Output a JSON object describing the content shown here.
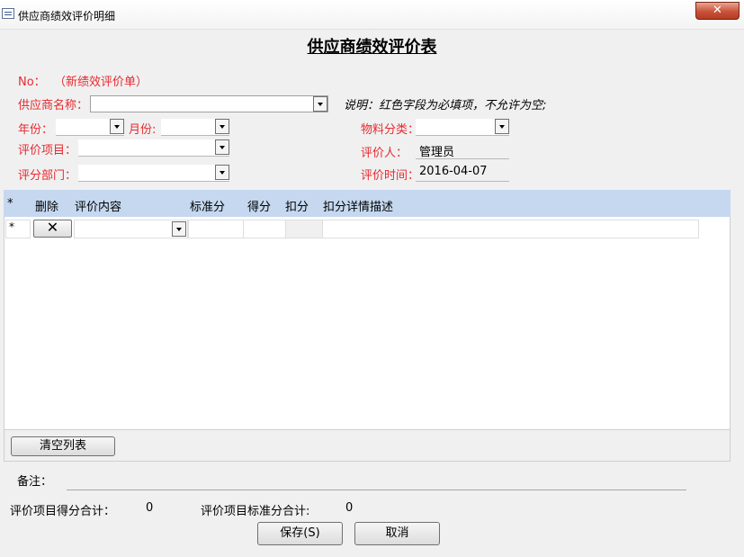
{
  "window": {
    "title": "供应商绩效评价明细",
    "close_label": "✕"
  },
  "form": {
    "title": "供应商绩效评价表",
    "no_label": "No：",
    "no_value": "（新绩效评价单）",
    "supplier_label": "供应商名称：",
    "supplier_value": "",
    "note_text": "说明：红色字段为必填项，不允许为空;",
    "year_label": "年份：",
    "year_value": "",
    "month_label": "月份:",
    "month_value": "",
    "material_label": "物料分类：",
    "material_value": "",
    "item_label": "评价项目：",
    "item_value": "",
    "evaluator_label": "评价人：",
    "evaluator_value": "管理员",
    "dept_label": "评分部门：",
    "dept_value": "",
    "eval_time_label": "评价时间：",
    "eval_time_value": "2016-04-07"
  },
  "grid": {
    "headers": [
      "*",
      "删除",
      "评价内容",
      "标准分",
      "得分",
      "扣分",
      "扣分详情描述"
    ],
    "new_row_marker": "*",
    "delete_glyph": "✕"
  },
  "actions": {
    "clear_list_label": "清空列表",
    "save_label": "保存(S)",
    "cancel_label": "取消"
  },
  "summary": {
    "remarks_label": "备注：",
    "remarks_value": "",
    "score_total_label": "评价项目得分合计：",
    "score_total_value": "0",
    "standard_total_label": "评价项目标准分合计:",
    "standard_total_value": "0"
  },
  "colors": {
    "required_label": "#e8292f",
    "grid_header": "#c5d8f0"
  }
}
